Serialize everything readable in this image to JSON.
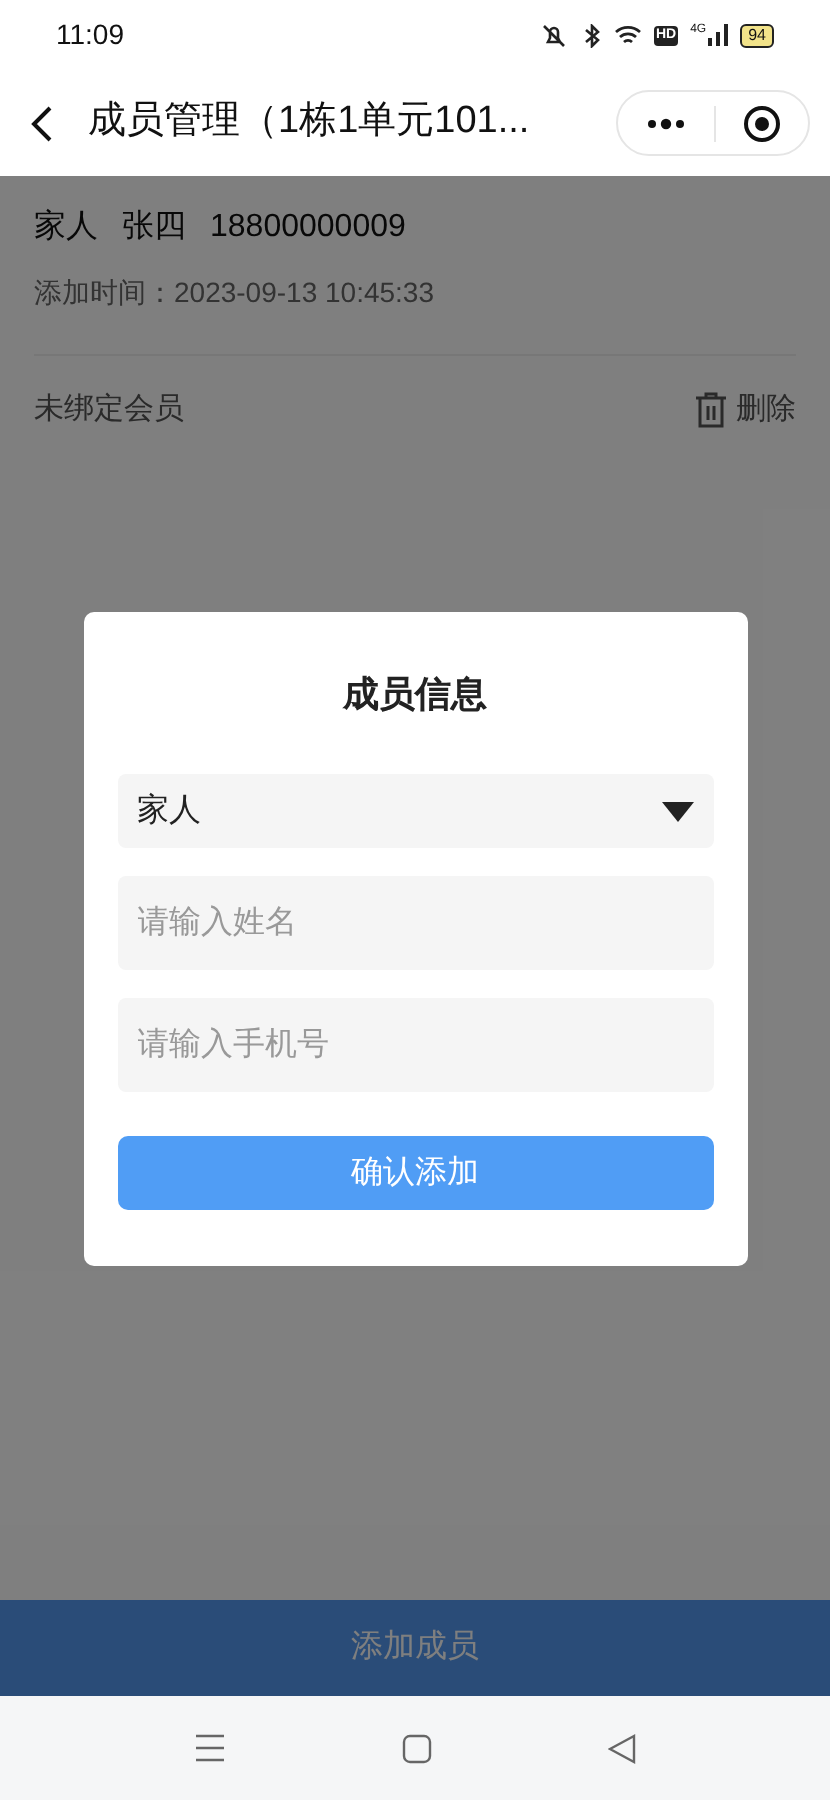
{
  "status_bar": {
    "time": "11:09",
    "hd": "HD",
    "network": "4G",
    "battery": "94"
  },
  "header": {
    "title": "成员管理（1栋1单元101..."
  },
  "member": {
    "relation": "家人",
    "name": "张四",
    "phone": "18800000009",
    "added_label": "添加时间：",
    "added_time": "2023-09-13 10:45:33",
    "bind_status": "未绑定会员",
    "delete": "删除"
  },
  "bottom_button": "添加成员",
  "dialog": {
    "title": "成员信息",
    "select": {
      "value": "家人"
    },
    "fields": [
      {
        "placeholder": "请输入姓名"
      },
      {
        "placeholder": "请输入手机号"
      }
    ],
    "confirm": "确认添加"
  }
}
